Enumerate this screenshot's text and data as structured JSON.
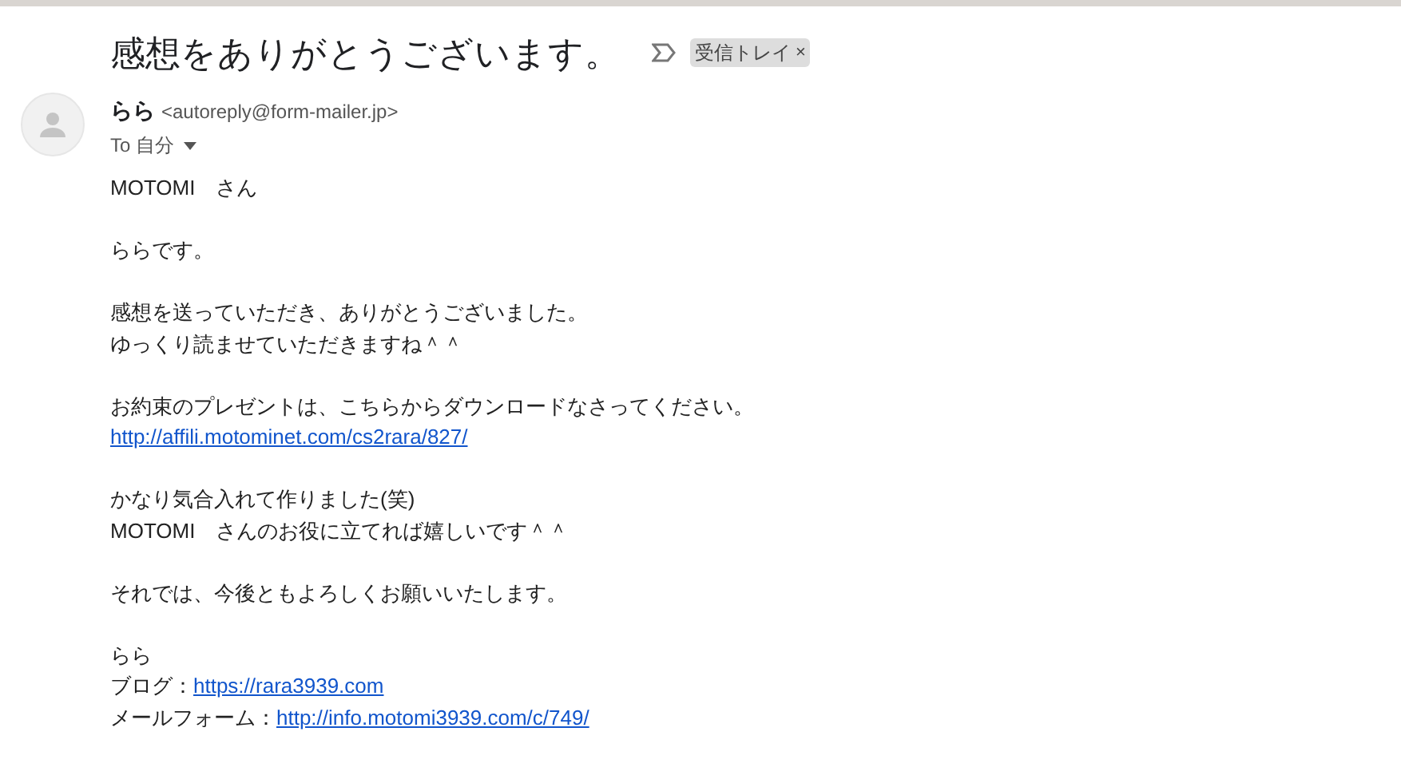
{
  "subject": "感想をありがとうございます。",
  "label": {
    "text": "受信トレイ",
    "close": "×"
  },
  "sender": {
    "name": "らら",
    "email": "<autoreply@form-mailer.jp>",
    "to": "To 自分"
  },
  "paragraphs": [
    [
      {
        "kind": "text",
        "text": "MOTOMI　さん"
      }
    ],
    [
      {
        "kind": "text",
        "text": "ららです。"
      }
    ],
    [
      {
        "kind": "text",
        "text": "感想を送っていただき、ありがとうございました。"
      },
      {
        "kind": "text",
        "text": "ゆっくり読ませていただきますね＾＾"
      }
    ],
    [
      {
        "kind": "text",
        "text": "お約束のプレゼントは、こちらからダウンロードなさってください。"
      },
      {
        "kind": "link",
        "link": "http://affili.motominet.com/cs2rara/827/"
      }
    ],
    [
      {
        "kind": "text",
        "text": "かなり気合入れて作りました(笑)"
      },
      {
        "kind": "text",
        "text": "MOTOMI　さんのお役に立てれば嬉しいです＾＾"
      }
    ],
    [
      {
        "kind": "text",
        "text": "それでは、今後ともよろしくお願いいたします。"
      }
    ],
    [
      {
        "kind": "text",
        "text": "らら"
      },
      {
        "kind": "labeled",
        "text": "ブログ：",
        "link": "https://rara3939.com"
      },
      {
        "kind": "labeled",
        "text": "メールフォーム：",
        "link": "http://info.motomi3939.com/c/749/"
      }
    ]
  ]
}
